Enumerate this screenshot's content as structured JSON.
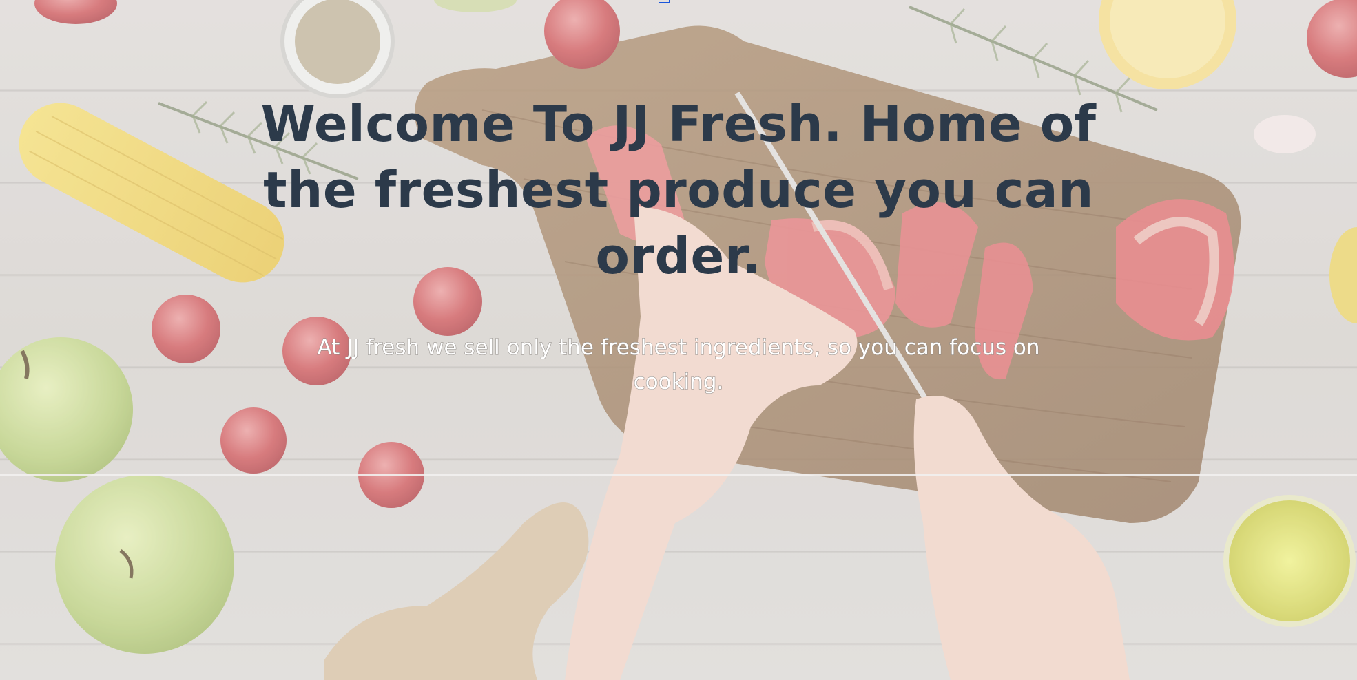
{
  "hero": {
    "title": "Welcome To JJ Fresh. Home of the freshest produce you can order.",
    "subtitle": "At JJ fresh we sell only the freshest ingredients, so you can focus on cooking."
  },
  "colors": {
    "title_text": "#2c3a4a",
    "subtitle_text": "#ffffff",
    "background": "#dcd9d6"
  },
  "background_image": {
    "icon": "kitchen-produce-background"
  }
}
